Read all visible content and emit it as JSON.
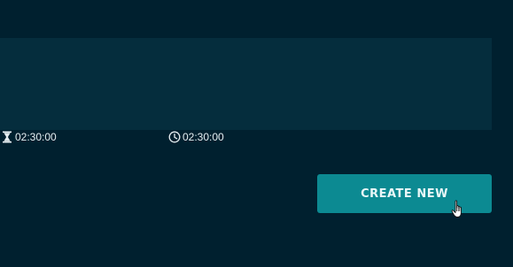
{
  "card": {
    "duration": {
      "icon": "hourglass-icon",
      "value": "02:30:00"
    },
    "time": {
      "icon": "clock-icon",
      "value": "02:30:00"
    }
  },
  "actions": {
    "create_new_label": "CREATE NEW"
  },
  "colors": {
    "background": "#00202f",
    "card": "#052d3d",
    "accent": "#0c8a92"
  }
}
